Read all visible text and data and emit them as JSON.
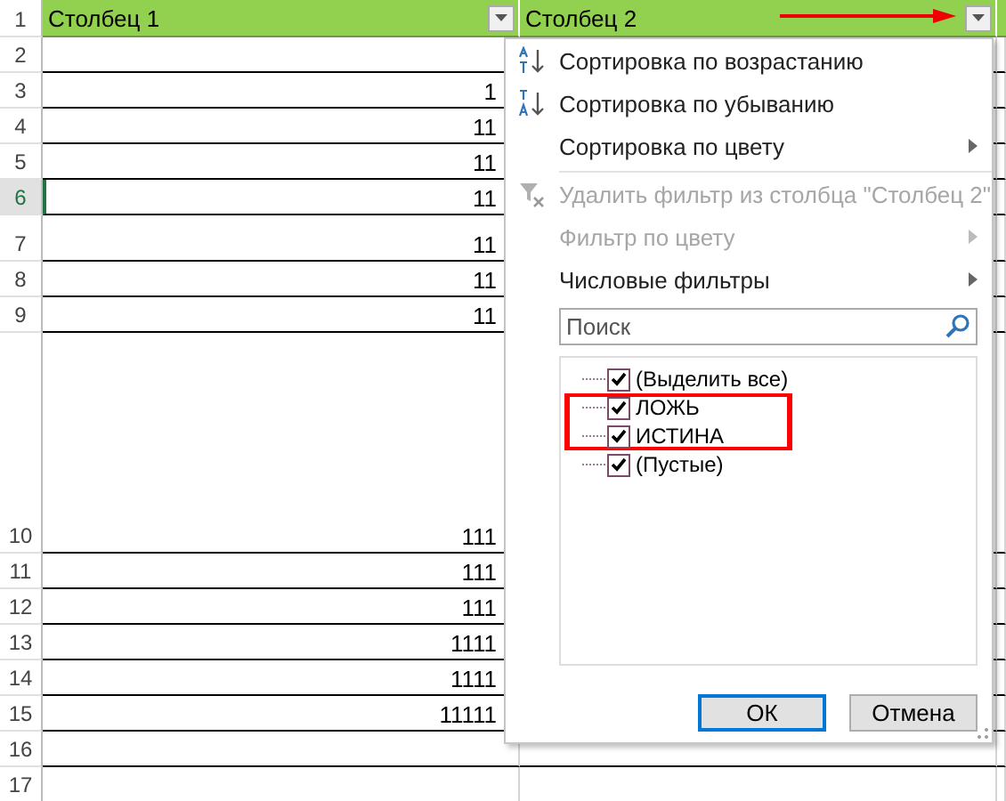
{
  "sheet": {
    "columns": [
      {
        "header": "Столбец 1"
      },
      {
        "header": "Столбец 2"
      }
    ],
    "rows": [
      {
        "number": "1",
        "selected": false,
        "kind": "header"
      },
      {
        "number": "2",
        "selected": false
      },
      {
        "number": "3",
        "value": "1",
        "selected": false
      },
      {
        "number": "4",
        "value": "11",
        "selected": false
      },
      {
        "number": "5",
        "value": "11",
        "selected": false
      },
      {
        "number": "6",
        "value": "11",
        "selected": true
      },
      {
        "number": "7",
        "value": "11",
        "selected": false
      },
      {
        "number": "8",
        "value": "11",
        "selected": false
      },
      {
        "number": "9",
        "value": "11",
        "selected": false
      },
      {
        "number": "10",
        "value": "111",
        "selected": false
      },
      {
        "number": "11",
        "value": "111",
        "selected": false
      },
      {
        "number": "12",
        "value": "111",
        "selected": false
      },
      {
        "number": "13",
        "value": "1111",
        "selected": false
      },
      {
        "number": "14",
        "value": "1111",
        "selected": false
      },
      {
        "number": "15",
        "value": "11111",
        "selected": false
      },
      {
        "number": "16",
        "selected": false
      },
      {
        "number": "17",
        "selected": false
      }
    ]
  },
  "filter_menu": {
    "items": [
      {
        "kind": "sort-asc",
        "label": "Сортировка по возрастанию",
        "disabled": false,
        "submenu": false
      },
      {
        "kind": "sort-desc",
        "label": "Сортировка по убыванию",
        "disabled": false,
        "submenu": false
      },
      {
        "kind": "plain",
        "label": "Сортировка по цвету",
        "disabled": false,
        "submenu": true
      },
      {
        "kind": "clear-filter",
        "label": "Удалить фильтр из столбца \"Столбец 2\"",
        "disabled": true,
        "submenu": false
      },
      {
        "kind": "plain",
        "label": "Фильтр по цвету",
        "disabled": true,
        "submenu": true
      },
      {
        "kind": "plain",
        "label": "Числовые фильтры",
        "disabled": false,
        "submenu": true
      }
    ],
    "search": {
      "placeholder": "Поиск"
    },
    "values": [
      {
        "label": "(Выделить все)",
        "checked": true,
        "highlighted": false
      },
      {
        "label": "ЛОЖЬ",
        "checked": true,
        "highlighted": true
      },
      {
        "label": "ИСТИНА",
        "checked": true,
        "highlighted": true
      },
      {
        "label": "(Пустые)",
        "checked": true,
        "highlighted": false
      }
    ],
    "buttons": [
      {
        "label": "ОК",
        "default": true
      },
      {
        "label": "Отмена",
        "default": false
      }
    ]
  }
}
